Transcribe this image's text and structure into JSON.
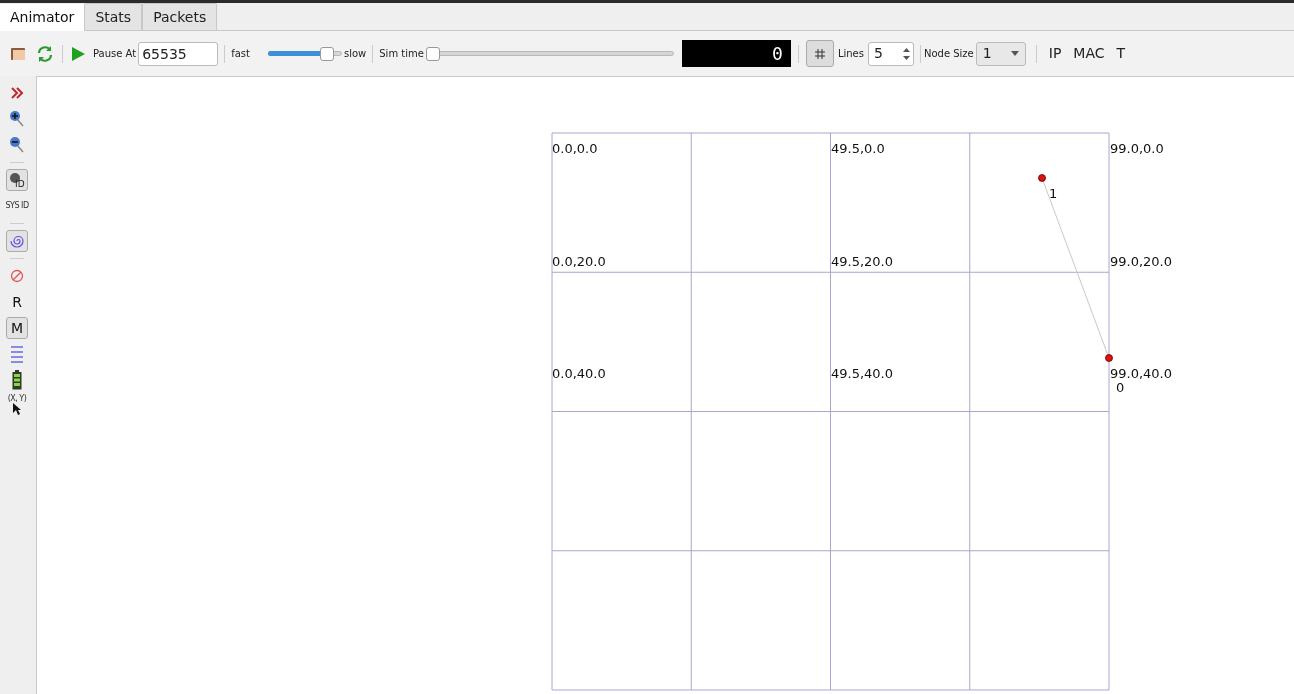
{
  "tabs": [
    {
      "label": "Animator",
      "selected": true
    },
    {
      "label": "Stats",
      "selected": false
    },
    {
      "label": "Packets",
      "selected": false
    }
  ],
  "toolbar": {
    "pause_at_label": "Pause At",
    "pause_at_value": "65535",
    "speed_fast": "fast",
    "speed_slow": "slow",
    "speed": {
      "level": 0.87
    },
    "sim_time_label": "Sim time",
    "sim_time": {
      "level": 0
    },
    "time_display": "0",
    "grid_on": true,
    "lines_label": "Lines",
    "lines_value": "5",
    "node_size_label": "Node Size",
    "node_size_value": "1",
    "ip": "IP",
    "mac": "MAC",
    "t": "T"
  },
  "sidebar": [
    {
      "kind": "chevrons",
      "on": false
    },
    {
      "kind": "zoom-in",
      "on": false
    },
    {
      "kind": "zoom-out",
      "on": false
    },
    {
      "kind": "sep"
    },
    {
      "kind": "node-id",
      "on": true,
      "label": "ID"
    },
    {
      "kind": "sys-id",
      "on": false,
      "label": "SYS ID"
    },
    {
      "kind": "sep"
    },
    {
      "kind": "spiral",
      "on": true
    },
    {
      "kind": "sep"
    },
    {
      "kind": "no-entry",
      "on": false
    },
    {
      "kind": "letter",
      "label": "R",
      "on": false
    },
    {
      "kind": "letter",
      "label": "M",
      "on": true
    },
    {
      "kind": "lines",
      "on": false
    },
    {
      "kind": "battery",
      "on": false
    },
    {
      "kind": "cursor",
      "label": "(X, Y)",
      "on": false
    }
  ],
  "canvas": {
    "grid_labels": [
      "0.0,0.0",
      "49.5,0.0",
      "99.0,0.0",
      "0.0,20.0",
      "49.5,20.0",
      "99.0,20.0",
      "0.0,40.0",
      "49.5,40.0",
      "99.0,40.0"
    ],
    "nodes": [
      {
        "label": "0"
      },
      {
        "label": "1"
      }
    ]
  }
}
